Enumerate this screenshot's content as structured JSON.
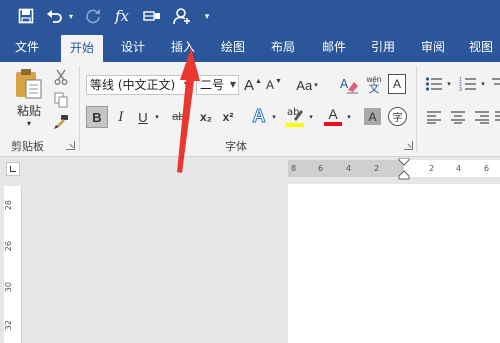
{
  "quick_access": {
    "save_icon": "save-icon",
    "undo_icon": "undo-icon",
    "redo_icon": "redo-icon",
    "formula_label": "fx",
    "customize_icon": "customize-quick-access-icon"
  },
  "tabs": [
    "文件",
    "开始",
    "设计",
    "插入",
    "绘图",
    "布局",
    "邮件",
    "引用",
    "审阅",
    "视图"
  ],
  "active_tab": "开始",
  "clipboard": {
    "paste_label": "粘贴",
    "group_label": "剪贴板"
  },
  "font": {
    "font_name": "等线 (中文正文)",
    "font_size": "二号",
    "bold": "B",
    "italic": "I",
    "underline": "U",
    "strike": "abc",
    "subscript": "x₂",
    "superscript": "x²",
    "grow_label": "A",
    "shrink_label": "A",
    "case_label": "Aa",
    "pinyin_top": "wén",
    "pinyin_bottom": "文",
    "border_char": "A",
    "shade_char": "A",
    "enclose_char": "字",
    "text_effect": "A",
    "font_color": "A",
    "group_label": "字体"
  },
  "ruler": {
    "horizontal_ticks": [
      "8",
      "6",
      "4",
      "2",
      "2",
      "4",
      "6"
    ],
    "vertical_ticks": [
      "28",
      "26",
      "30",
      "32"
    ]
  },
  "colors": {
    "brand": "#2b579a",
    "highlight": "#ffff00",
    "font_color": "#e81123",
    "arrow": "#e8382f"
  }
}
